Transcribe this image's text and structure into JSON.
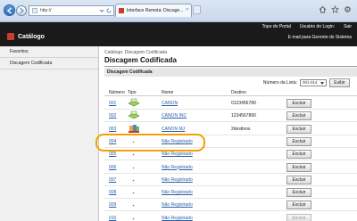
{
  "browser": {
    "url": "http://",
    "tab_title": "Interface Remota: Discage...",
    "tab_close": "×"
  },
  "header": {
    "top_links": [
      "Topo do Portal",
      "Usuário do Login:",
      "Sair"
    ],
    "logo_text": "Catálogo",
    "mail_link": "E-mail para Gerente do Sistema"
  },
  "sidebar": {
    "items": [
      {
        "label": "Favoritos"
      },
      {
        "label": "Discagem Codificada"
      }
    ]
  },
  "main": {
    "breadcrumb": "Catálogo: Discagem Codificada",
    "title": "Discagem Codificada",
    "section": "Discagem Codificada",
    "list_number_label": "Número da Lista:",
    "list_number_value": "001-014",
    "exibir_label": "Exibir",
    "columns": {
      "numero": "Número",
      "tipo": "Tipo",
      "nome": "Nome",
      "destino": "Destino"
    },
    "rows": [
      {
        "num": "001",
        "type": "fax",
        "name": "CANON",
        "dest": "0123456789",
        "action": "Excluir"
      },
      {
        "num": "002",
        "type": "fax",
        "name": "CANON INC",
        "dest": "1234567890",
        "action": "Excluir"
      },
      {
        "num": "003",
        "type": "group",
        "name": "CANON MJ",
        "dest": "2destinos",
        "action": "Excluir"
      },
      {
        "num": "004",
        "type": "none",
        "name": "Não Registrado",
        "dest": "",
        "action": "Excluir"
      },
      {
        "num": "005",
        "type": "none",
        "name": "Não Registrado",
        "dest": "",
        "action": "Excluir"
      },
      {
        "num": "006",
        "type": "none",
        "name": "Não Registrado",
        "dest": "",
        "action": "Excluir"
      },
      {
        "num": "007",
        "type": "none",
        "name": "Não Registrado",
        "dest": "",
        "action": "Excluir"
      },
      {
        "num": "008",
        "type": "none",
        "name": "Não Registrado",
        "dest": "",
        "action": "Excluir"
      },
      {
        "num": "009",
        "type": "none",
        "name": "Não Registrado",
        "dest": "",
        "action": "Excluir"
      },
      {
        "num": "010",
        "type": "none",
        "name": "Não Registrado",
        "dest": "",
        "action": "Excluir"
      }
    ]
  },
  "colors": {
    "header_bg": "#1a1a1a",
    "link": "#2b5ea8",
    "highlight": "#f2a100",
    "logo": "#c93d2c"
  }
}
